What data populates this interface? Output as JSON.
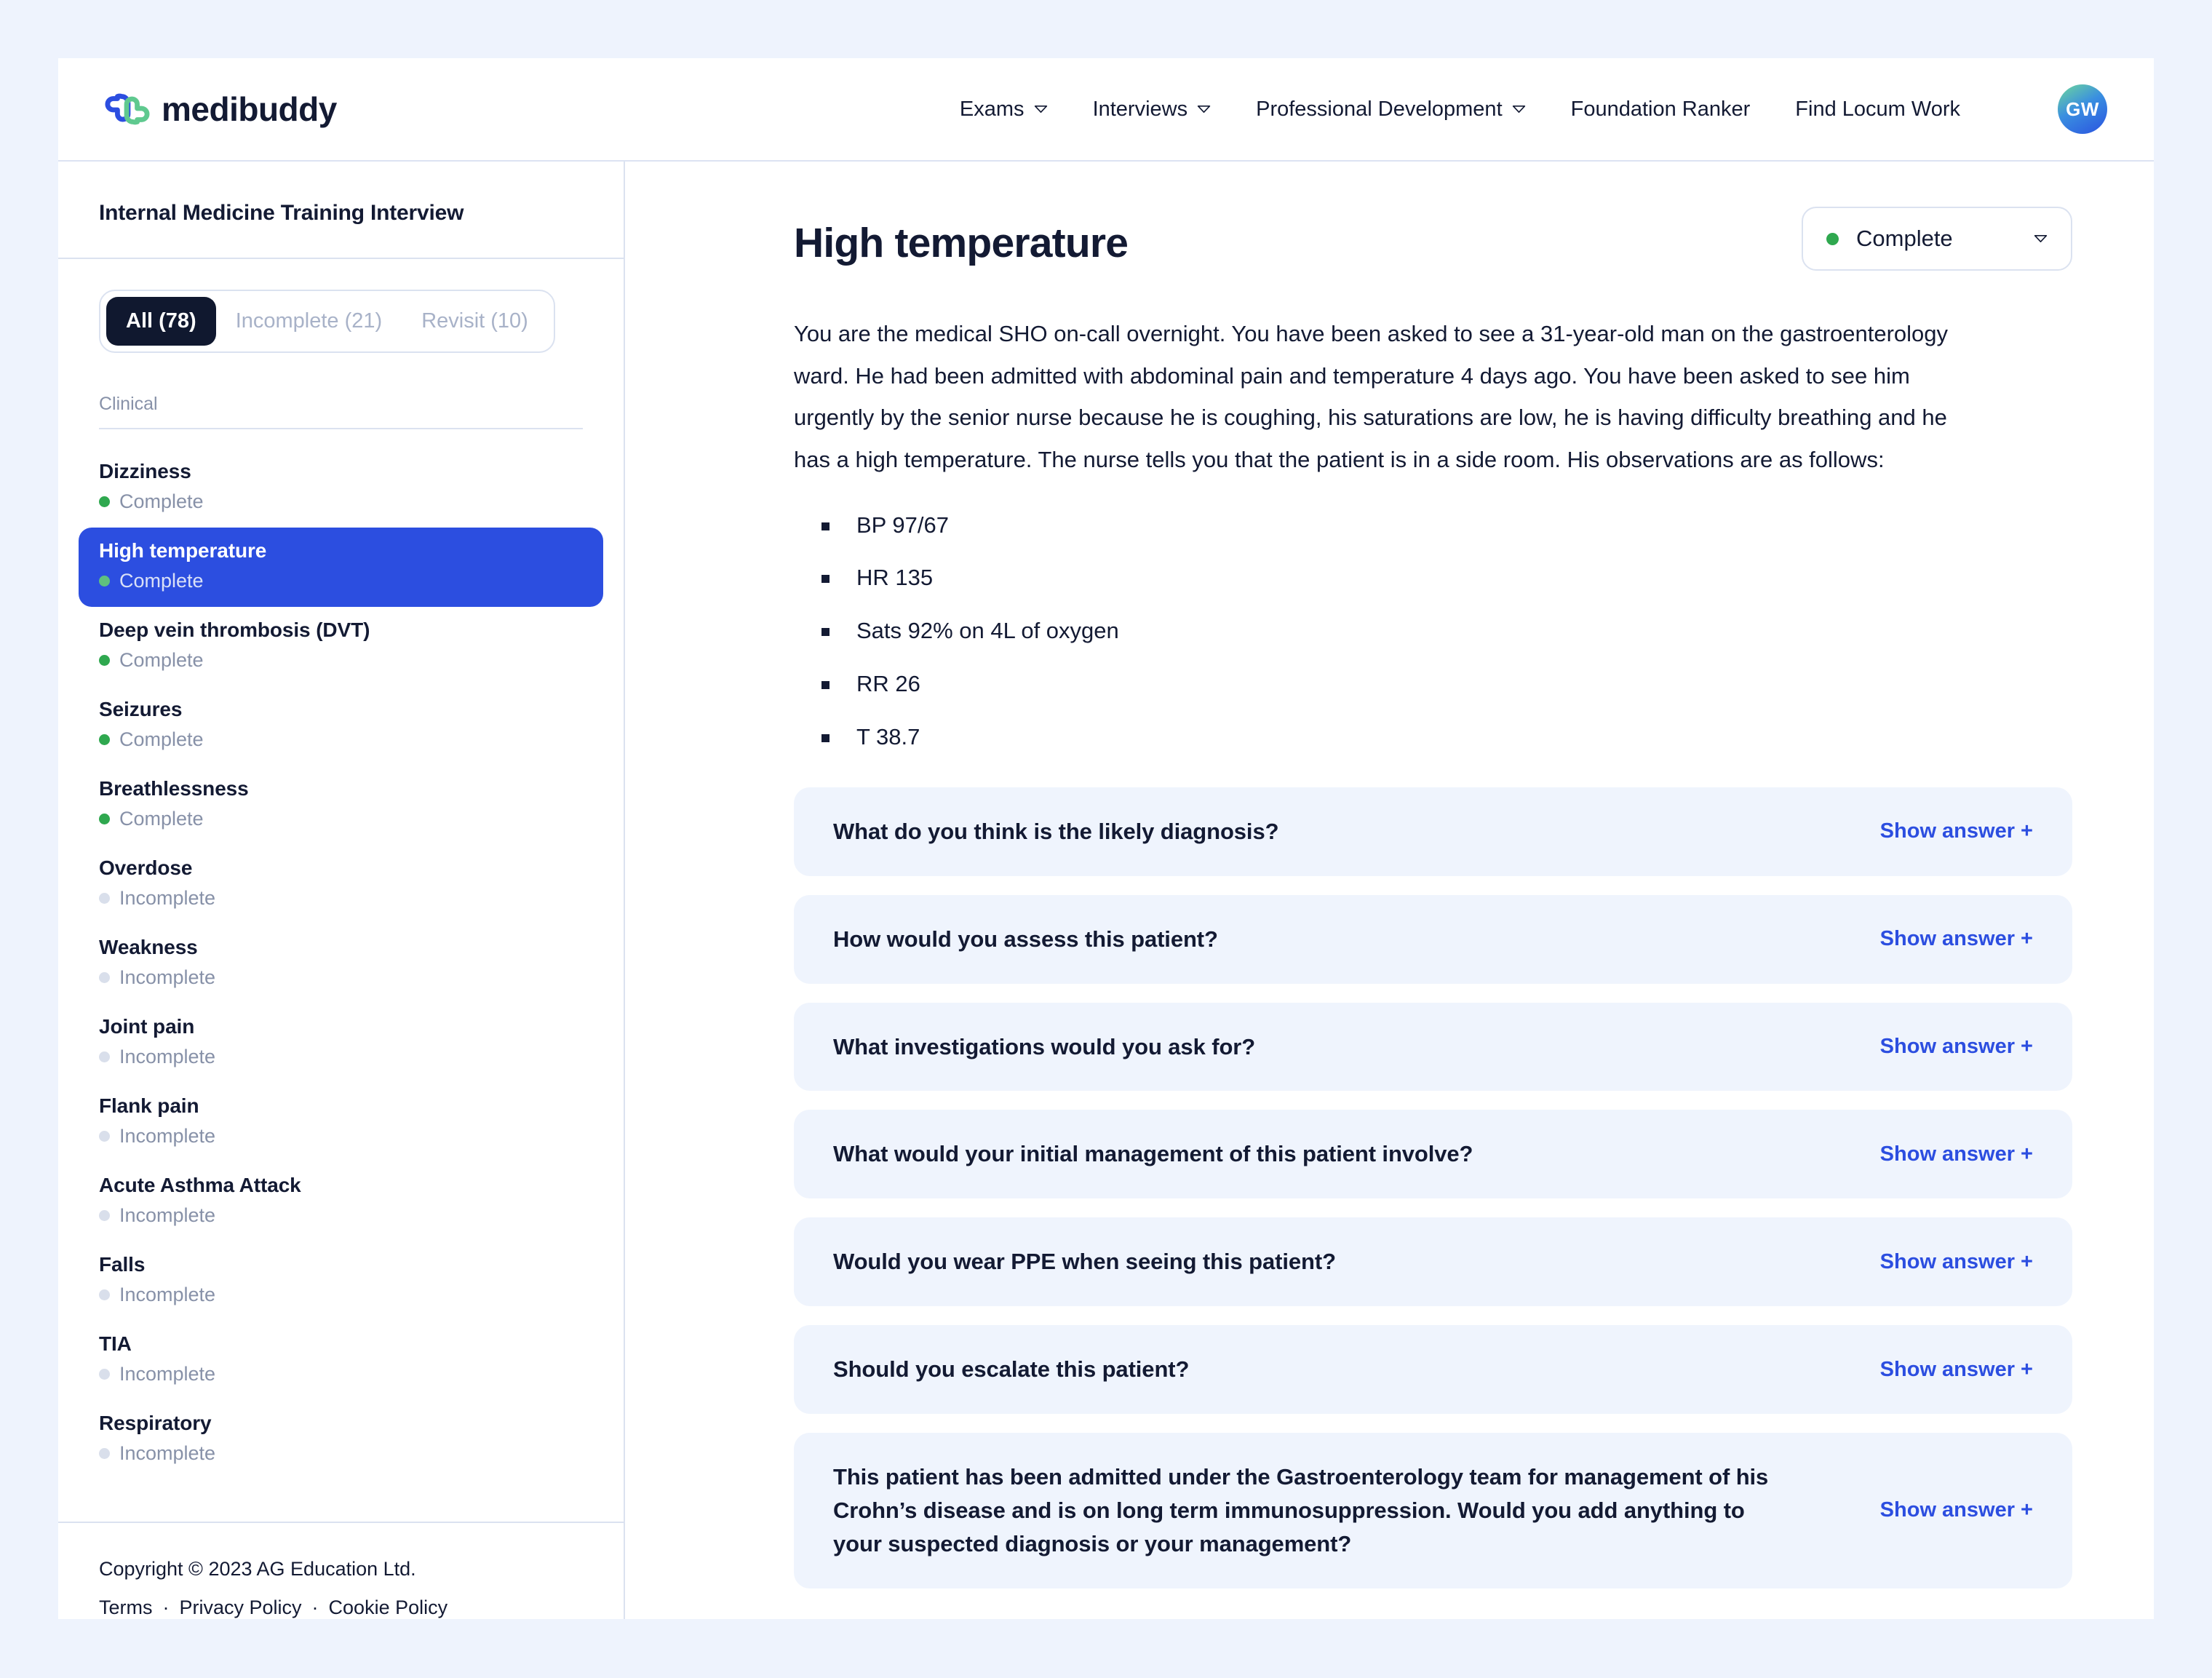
{
  "brand": {
    "name": "medibuddy",
    "mark": "medibuddy-logo-icon"
  },
  "nav": {
    "items": [
      {
        "label": "Exams",
        "has_dropdown": true
      },
      {
        "label": "Interviews",
        "has_dropdown": true
      },
      {
        "label": "Professional Development",
        "has_dropdown": true
      },
      {
        "label": "Foundation Ranker",
        "has_dropdown": false
      },
      {
        "label": "Find Locum Work",
        "has_dropdown": false
      }
    ],
    "avatar_initials": "GW"
  },
  "sidebar": {
    "title": "Internal Medicine Training Interview",
    "filters": [
      {
        "label": "All (78)",
        "active": true
      },
      {
        "label": "Incomplete (21)",
        "active": false
      },
      {
        "label": "Revisit (10)",
        "active": false
      }
    ],
    "section_label": "Clinical",
    "topics": [
      {
        "name": "Dizziness",
        "status": "Complete",
        "selected": false
      },
      {
        "name": "High temperature",
        "status": "Complete",
        "selected": true
      },
      {
        "name": "Deep vein thrombosis (DVT)",
        "status": "Complete",
        "selected": false
      },
      {
        "name": "Seizures",
        "status": "Complete",
        "selected": false
      },
      {
        "name": "Breathlessness",
        "status": "Complete",
        "selected": false
      },
      {
        "name": "Overdose",
        "status": "Incomplete",
        "selected": false
      },
      {
        "name": "Weakness",
        "status": "Incomplete",
        "selected": false
      },
      {
        "name": "Joint pain",
        "status": "Incomplete",
        "selected": false
      },
      {
        "name": "Flank pain",
        "status": "Incomplete",
        "selected": false
      },
      {
        "name": "Acute Asthma Attack",
        "status": "Incomplete",
        "selected": false
      },
      {
        "name": "Falls",
        "status": "Incomplete",
        "selected": false
      },
      {
        "name": "TIA",
        "status": "Incomplete",
        "selected": false
      },
      {
        "name": "Respiratory",
        "status": "Incomplete",
        "selected": false
      }
    ],
    "footer": {
      "copyright": "Copyright © 2023 AG Education Ltd.",
      "links": [
        "Terms",
        "Privacy Policy",
        "Cookie Policy"
      ],
      "separator": "·"
    }
  },
  "main": {
    "title": "High temperature",
    "status": {
      "label": "Complete",
      "state": "complete"
    },
    "scenario": "You are the medical SHO on-call overnight. You have been asked to see a 31-year-old man on the gastroenterology ward. He had been admitted with abdominal pain and temperature 4 days ago.  You have been asked to see him urgently by the senior nurse because he is coughing, his saturations are low, he is having difficulty breathing and he has a high temperature. The nurse tells you that the patient is in a side room. His observations are as follows:",
    "observations": [
      "BP 97/67",
      "HR 135",
      "Sats 92% on 4L of oxygen",
      "RR 26",
      "T 38.7"
    ],
    "show_answer_label": "Show answer +",
    "questions": [
      "What do you think is the likely diagnosis?",
      "How would you assess this patient?",
      "What investigations would you ask for?",
      "What would your initial management of this patient involve?",
      "Would you wear PPE when seeing this patient?",
      "Should you escalate this patient?",
      "This patient has been admitted under the Gastroenterology team for management of his Crohn’s disease and is on long term immunosuppression. Would you add anything to your suspected diagnosis or your management?"
    ]
  },
  "colors": {
    "page_background": "#eef3fd",
    "accent_blue": "#2c4ee0",
    "brand_green": "#5fc98f",
    "status_complete": "#2fa84f",
    "status_incomplete": "#d9dfeb",
    "card_background": "#eff4fd",
    "text_primary": "#131a33",
    "text_muted": "#8791a8",
    "filter_active_background": "#10182f"
  }
}
